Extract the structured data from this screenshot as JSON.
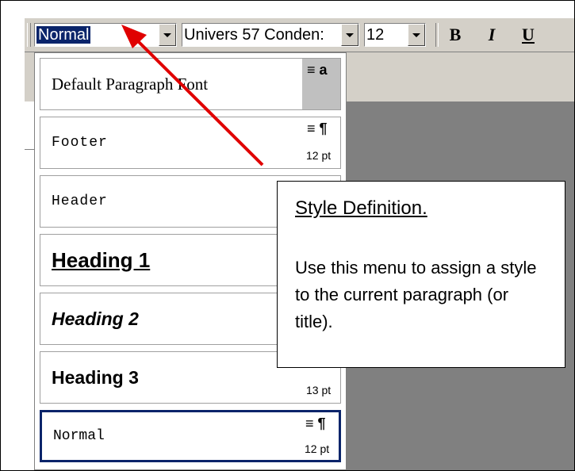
{
  "toolbar": {
    "style_value": "Normal",
    "font_value": "Univers 57 Conden:",
    "size_value": "12",
    "bold_label": "B",
    "italic_label": "I",
    "underline_label": "U"
  },
  "style_list": [
    {
      "name": "Default Paragraph Font",
      "glyphs": "≡ a",
      "size": ""
    },
    {
      "name": "Footer",
      "glyphs": "≡ ¶",
      "size": "12 pt"
    },
    {
      "name": "Header",
      "glyphs": "",
      "size": ""
    },
    {
      "name": "Heading 1",
      "glyphs": "",
      "size": ""
    },
    {
      "name": "Heading 2",
      "glyphs": "",
      "size": ""
    },
    {
      "name": "Heading 3",
      "glyphs": "≡ ¶",
      "size": "13 pt"
    },
    {
      "name": "Normal",
      "glyphs": "≡ ¶",
      "size": "12 pt"
    }
  ],
  "callout": {
    "title": "Style Definition.",
    "body": "Use this menu to assign a style to the current paragraph (or title)."
  },
  "colors": {
    "arrow": "#e00000",
    "selection": "#0a246a",
    "toolbar": "#d4d0c8",
    "document_bg": "#808080"
  }
}
